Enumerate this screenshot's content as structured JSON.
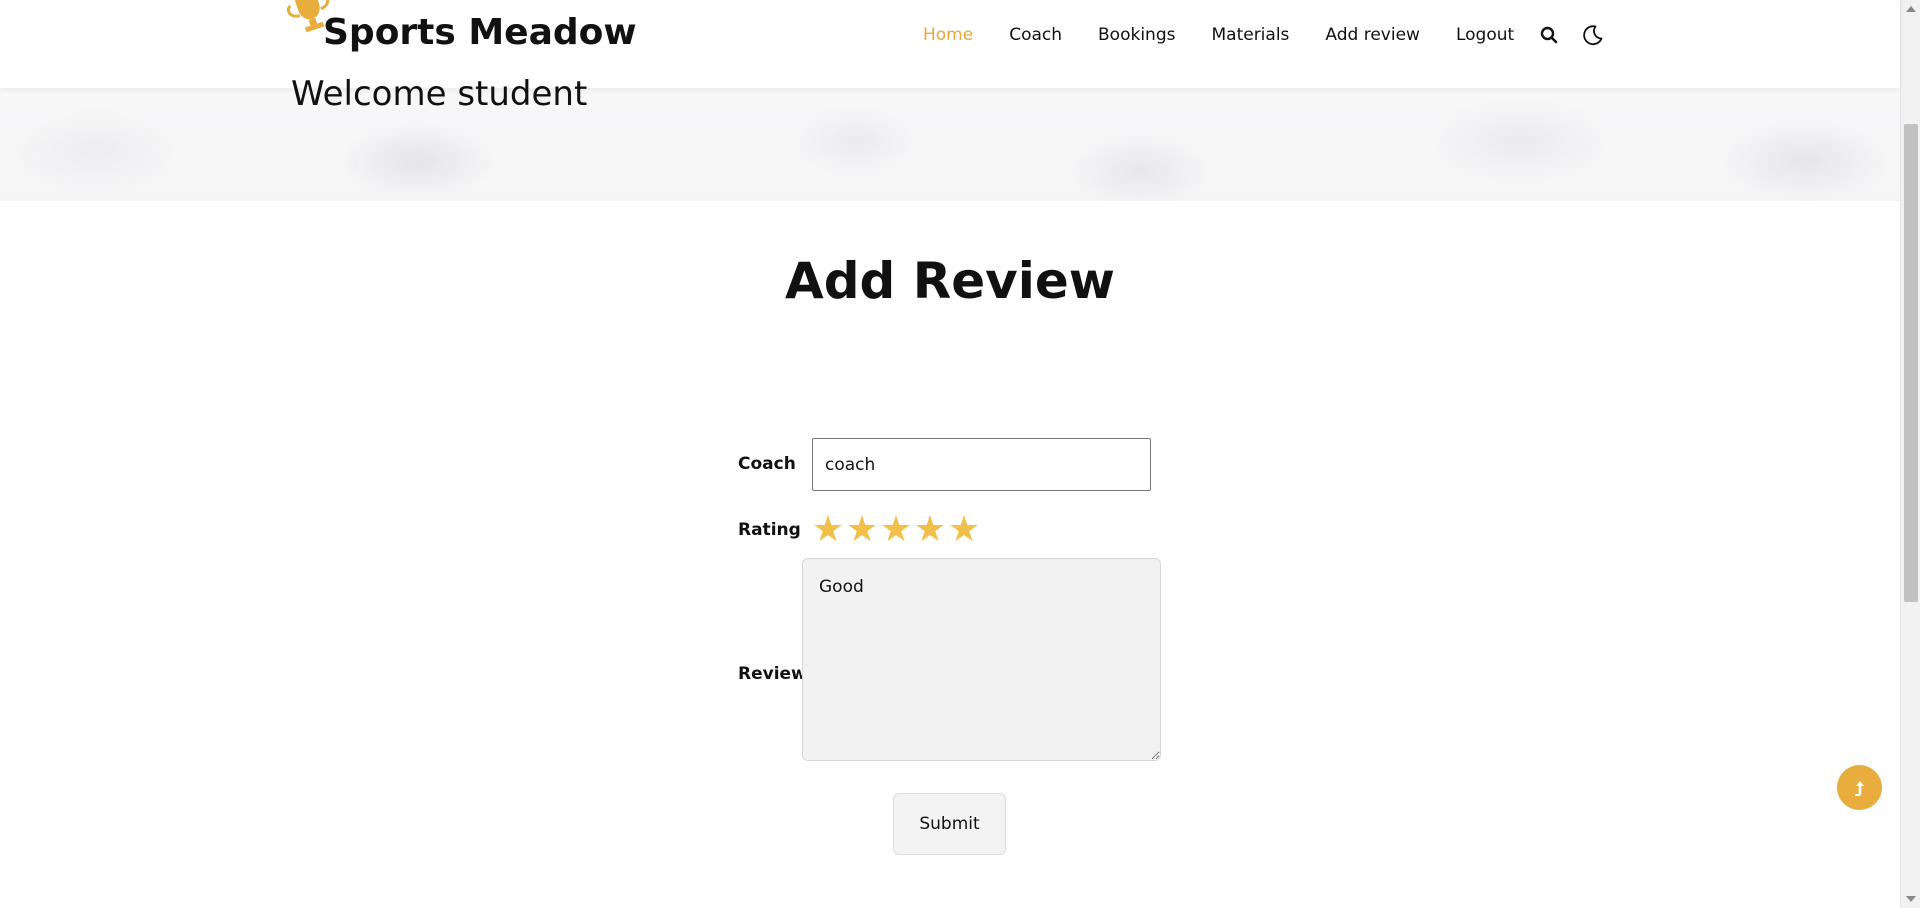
{
  "header": {
    "brand_name": "Sports Meadow",
    "brand_icon": "trophy-icon",
    "nav": [
      {
        "label": "Home",
        "active": true
      },
      {
        "label": "Coach",
        "active": false
      },
      {
        "label": "Bookings",
        "active": false
      },
      {
        "label": "Materials",
        "active": false
      },
      {
        "label": "Add review",
        "active": false
      },
      {
        "label": "Logout",
        "active": false
      }
    ],
    "icons": [
      "search-icon",
      "moon-icon"
    ]
  },
  "hero": {
    "welcome_text": "Welcome student"
  },
  "main": {
    "title": "Add Review",
    "form": {
      "coach_label": "Coach",
      "coach_value": "coach",
      "rating_label": "Rating",
      "rating_value": 5,
      "rating_max": 5,
      "review_label": "Review",
      "review_value": "Good",
      "submit_label": "Submit"
    }
  },
  "colors": {
    "accent": "#e8a93a",
    "star": "#f0c04a"
  }
}
